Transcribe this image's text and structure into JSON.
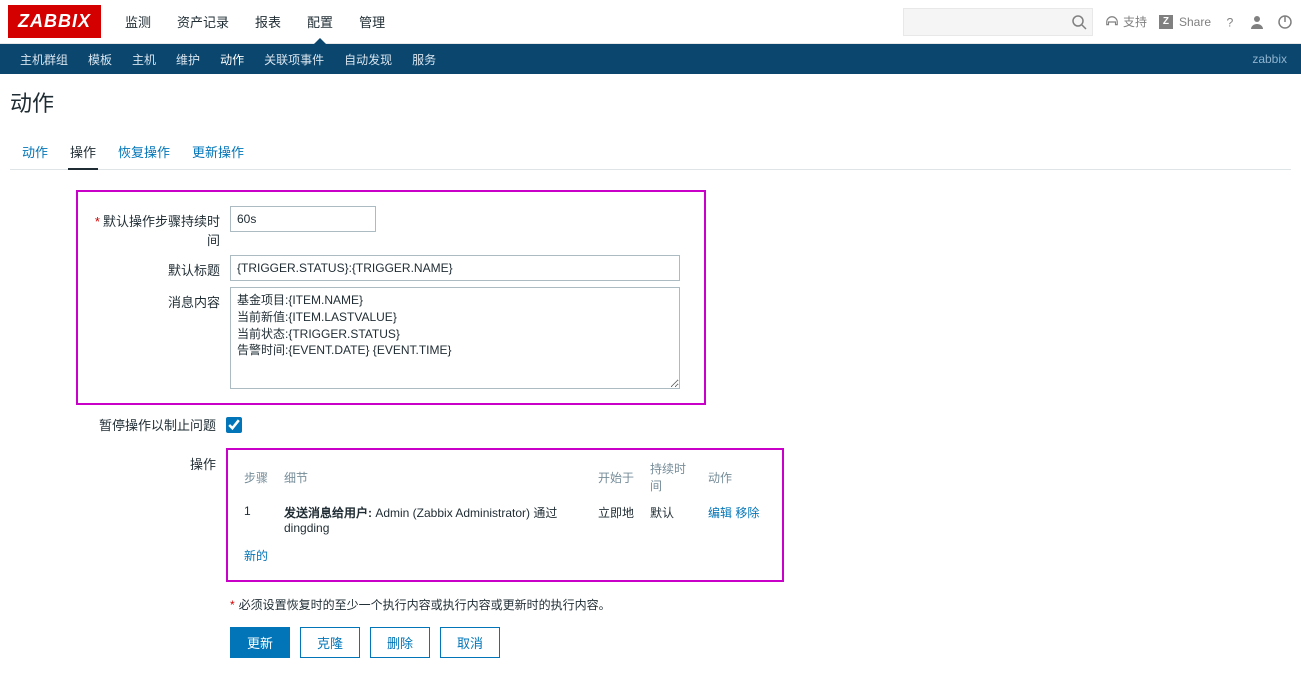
{
  "brand": "ZABBIX",
  "topMenu": [
    "监测",
    "资产记录",
    "报表",
    "配置",
    "管理"
  ],
  "topMenuActive": 3,
  "header": {
    "support": "支持",
    "share": "Share"
  },
  "subMenu": [
    "主机群组",
    "模板",
    "主机",
    "维护",
    "动作",
    "关联项事件",
    "自动发现",
    "服务"
  ],
  "subMenuActive": 4,
  "subRight": "zabbix",
  "pageTitle": "动作",
  "tabs": [
    "动作",
    "操作",
    "恢复操作",
    "更新操作"
  ],
  "tabsActive": 1,
  "form": {
    "durationLabel": "默认操作步骤持续时间",
    "durationValue": "60s",
    "titleLabel": "默认标题",
    "titleValue": "{TRIGGER.STATUS}:{TRIGGER.NAME}",
    "msgLabel": "消息内容",
    "msgValue": "基金项目:{ITEM.NAME}\n当前新值:{ITEM.LASTVALUE}\n当前状态:{TRIGGER.STATUS}\n告警时间:{EVENT.DATE} {EVENT.TIME}",
    "pauseLabel": "暂停操作以制止问题",
    "pauseChecked": true,
    "opsLabel": "操作"
  },
  "opsTable": {
    "cols": {
      "step": "步骤",
      "detail": "细节",
      "start": "开始于",
      "duration": "持续时间",
      "action": "动作"
    },
    "row": {
      "step": "1",
      "detailBold": "发送消息给用户:",
      "detailRest": " Admin (Zabbix Administrator) 通过 dingding",
      "start": "立即地",
      "duration": "默认",
      "edit": "编辑",
      "remove": "移除"
    },
    "newLink": "新的"
  },
  "hint": "必须设置恢复时的至少一个执行内容或执行内容或更新时的执行内容。",
  "buttons": {
    "update": "更新",
    "clone": "克隆",
    "delete": "删除",
    "cancel": "取消"
  }
}
